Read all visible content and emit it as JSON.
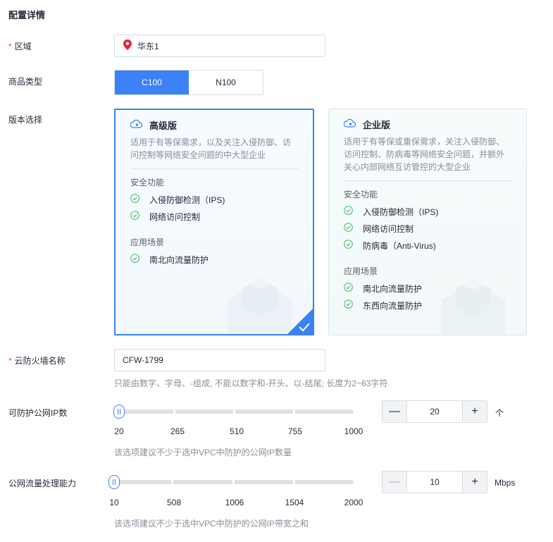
{
  "section_title": "配置详情",
  "required_mark": "*",
  "region": {
    "label": "区域",
    "value": "华东1"
  },
  "product_type": {
    "label": "商品类型",
    "options": [
      "C100",
      "N100"
    ],
    "selected": "C100"
  },
  "edition": {
    "label": "版本选择",
    "cards": [
      {
        "title": "高级版",
        "desc": "适用于有等保需求，以及关注入侵防御、访问控制等网络安全问题的中大型企业",
        "security_heading": "安全功能",
        "security_features": [
          "入侵防御检测（IPS)",
          "网络访问控制"
        ],
        "scenario_heading": "应用场景",
        "scenarios": [
          "南北向流量防护"
        ],
        "selected": true
      },
      {
        "title": "企业版",
        "desc": "适用于有等保或重保需求，关注入侵防御、访问控制、防病毒等网络安全问题，并额外关心内部网络互访管控的大型企业",
        "security_heading": "安全功能",
        "security_features": [
          "入侵防御检测（IPS)",
          "网络访问控制",
          "防病毒（Anti-Virus)"
        ],
        "scenario_heading": "应用场景",
        "scenarios": [
          "南北向流量防护",
          "东西向流量防护"
        ],
        "selected": false
      }
    ]
  },
  "firewall_name": {
    "label": "云防火墙名称",
    "value": "CFW-1799",
    "hint": "只能由数字、字母、-组成; 不能以数字和-开头、以-结尾; 长度为2~63字符"
  },
  "public_ip": {
    "label": "可防护公网IP数",
    "ticks": [
      "20",
      "265",
      "510",
      "755",
      "1000"
    ],
    "min": 20,
    "max": 1000,
    "value": "20",
    "unit": "个",
    "hint": "该选项建议不少于选中VPC中防护的公网IP数量"
  },
  "bandwidth": {
    "label": "公网流量处理能力",
    "ticks": [
      "10",
      "508",
      "1006",
      "1504",
      "2000"
    ],
    "min": 10,
    "max": 2000,
    "value": "10",
    "unit": "Mbps",
    "hint": "该选项建议不少于选中VPC中防护的公网IP带宽之和"
  },
  "stepper_minus": "—",
  "stepper_plus": "+",
  "colors": {
    "accent": "#3b82f6",
    "check": "#3cbc6c",
    "pin": "#e0233f"
  }
}
